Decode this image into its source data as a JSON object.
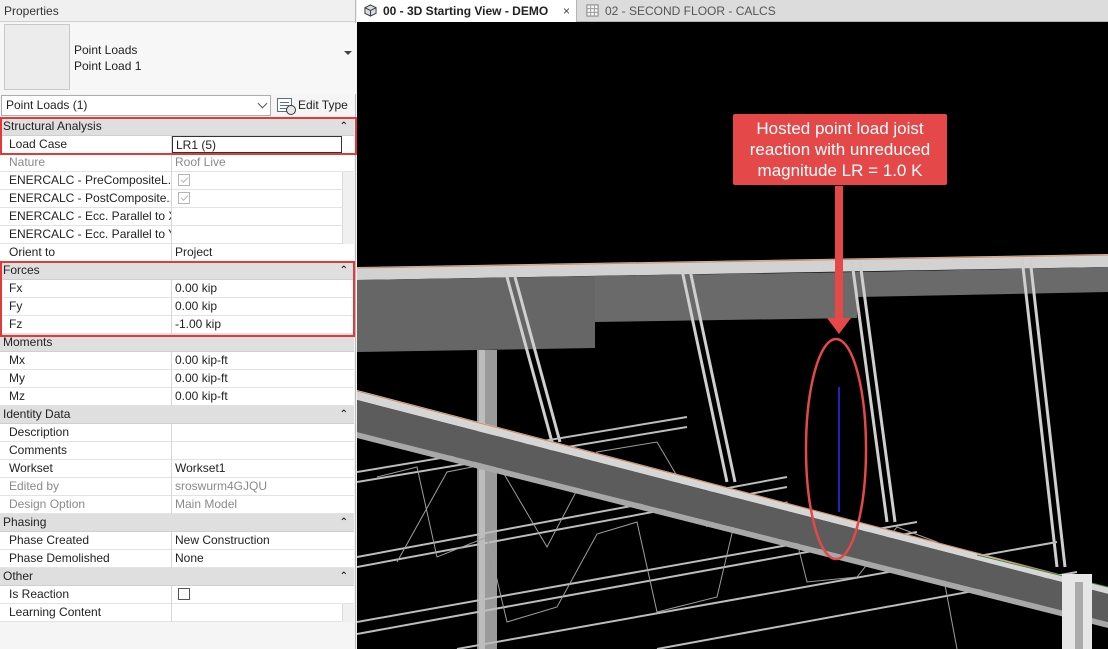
{
  "properties_panel": {
    "title": "Properties",
    "type_selector": {
      "family": "Point Loads",
      "name": "Point Load 1"
    },
    "instance_filter": "Point Loads (1)",
    "edit_type_label": "Edit Type",
    "sections": {
      "structural_analysis": {
        "label": "Structural Analysis",
        "load_case": {
          "label": "Load Case",
          "value": "LR1 (5)"
        },
        "nature": {
          "label": "Nature",
          "value": "Roof Live"
        },
        "enercalc_pre": {
          "label": "ENERCALC - PreCompositeL...",
          "checked": true
        },
        "enercalc_post": {
          "label": "ENERCALC - PostComposite...",
          "checked": true
        },
        "enercalc_ecc_xx": {
          "label": "ENERCALC - Ecc. Parallel to XX",
          "value": ""
        },
        "enercalc_ecc_yy": {
          "label": "ENERCALC - Ecc. Parallel to YY",
          "value": ""
        },
        "orient_to": {
          "label": "Orient to",
          "value": "Project"
        }
      },
      "forces": {
        "label": "Forces",
        "fx": {
          "label": "Fx",
          "value": "0.00 kip"
        },
        "fy": {
          "label": "Fy",
          "value": "0.00 kip"
        },
        "fz": {
          "label": "Fz",
          "value": "-1.00 kip"
        }
      },
      "moments": {
        "label": "Moments",
        "mx": {
          "label": "Mx",
          "value": "0.00 kip-ft"
        },
        "my": {
          "label": "My",
          "value": "0.00 kip-ft"
        },
        "mz": {
          "label": "Mz",
          "value": "0.00 kip-ft"
        }
      },
      "identity_data": {
        "label": "Identity Data",
        "description": {
          "label": "Description",
          "value": ""
        },
        "comments": {
          "label": "Comments",
          "value": ""
        },
        "workset": {
          "label": "Workset",
          "value": "Workset1"
        },
        "edited_by": {
          "label": "Edited by",
          "value": "sroswurm4GJQU"
        },
        "design_option": {
          "label": "Design Option",
          "value": "Main Model"
        }
      },
      "phasing": {
        "label": "Phasing",
        "phase_created": {
          "label": "Phase Created",
          "value": "New Construction"
        },
        "phase_demolished": {
          "label": "Phase Demolished",
          "value": "None"
        }
      },
      "other": {
        "label": "Other",
        "is_reaction": {
          "label": "Is Reaction",
          "checked": false
        },
        "learning_content": {
          "label": "Learning Content",
          "value": ""
        }
      }
    }
  },
  "tabs": [
    {
      "label": "00 - 3D Starting View - DEMO",
      "active": true,
      "close": "×"
    },
    {
      "label": "02 - SECOND FLOOR - CALCS",
      "active": false
    }
  ],
  "viewport": {
    "callout": "Hosted point load joist reaction with unreduced magnitude LR = 1.0 K",
    "colors": {
      "annotation": "#e44848",
      "load_line": "#2233ff",
      "beam_top": "#cfcfcf",
      "beam_side": "#5e5e5e",
      "background": "#000000"
    }
  },
  "collapse_glyph": "⌃"
}
